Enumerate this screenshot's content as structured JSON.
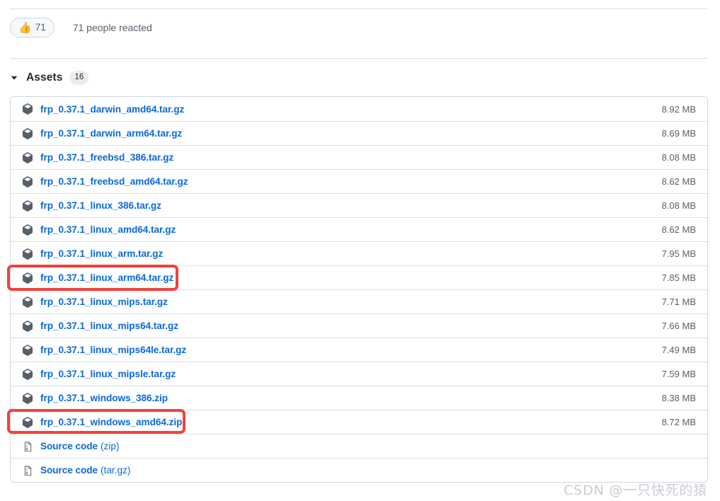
{
  "reactions": {
    "emoji": "thumbs-up-icon",
    "emoji_glyph": "👍",
    "count": "71",
    "summary": "71 people reacted"
  },
  "assets": {
    "toggle_icon": "chevron-down-icon",
    "title": "Assets",
    "count": "16",
    "rows": [
      {
        "icon": "package-icon",
        "name": "frp_0.37.1_darwin_amd64.tar.gz",
        "suffix": "",
        "size": "8.92 MB",
        "highlighted": false
      },
      {
        "icon": "package-icon",
        "name": "frp_0.37.1_darwin_arm64.tar.gz",
        "suffix": "",
        "size": "8.69 MB",
        "highlighted": false
      },
      {
        "icon": "package-icon",
        "name": "frp_0.37.1_freebsd_386.tar.gz",
        "suffix": "",
        "size": "8.08 MB",
        "highlighted": false
      },
      {
        "icon": "package-icon",
        "name": "frp_0.37.1_freebsd_amd64.tar.gz",
        "suffix": "",
        "size": "8.62 MB",
        "highlighted": false
      },
      {
        "icon": "package-icon",
        "name": "frp_0.37.1_linux_386.tar.gz",
        "suffix": "",
        "size": "8.08 MB",
        "highlighted": false
      },
      {
        "icon": "package-icon",
        "name": "frp_0.37.1_linux_amd64.tar.gz",
        "suffix": "",
        "size": "8.62 MB",
        "highlighted": false
      },
      {
        "icon": "package-icon",
        "name": "frp_0.37.1_linux_arm.tar.gz",
        "suffix": "",
        "size": "7.95 MB",
        "highlighted": false
      },
      {
        "icon": "package-icon",
        "name": "frp_0.37.1_linux_arm64.tar.gz",
        "suffix": "",
        "size": "7.85 MB",
        "highlighted": true
      },
      {
        "icon": "package-icon",
        "name": "frp_0.37.1_linux_mips.tar.gz",
        "suffix": "",
        "size": "7.71 MB",
        "highlighted": false
      },
      {
        "icon": "package-icon",
        "name": "frp_0.37.1_linux_mips64.tar.gz",
        "suffix": "",
        "size": "7.66 MB",
        "highlighted": false
      },
      {
        "icon": "package-icon",
        "name": "frp_0.37.1_linux_mips64le.tar.gz",
        "suffix": "",
        "size": "7.49 MB",
        "highlighted": false
      },
      {
        "icon": "package-icon",
        "name": "frp_0.37.1_linux_mipsle.tar.gz",
        "suffix": "",
        "size": "7.59 MB",
        "highlighted": false
      },
      {
        "icon": "package-icon",
        "name": "frp_0.37.1_windows_386.zip",
        "suffix": "",
        "size": "8.38 MB",
        "highlighted": false
      },
      {
        "icon": "package-icon",
        "name": "frp_0.37.1_windows_amd64.zip",
        "suffix": "",
        "size": "8.72 MB",
        "highlighted": true
      },
      {
        "icon": "file-zip-icon",
        "name": "Source code",
        "suffix": "(zip)",
        "size": "",
        "highlighted": false
      },
      {
        "icon": "file-zip-icon",
        "name": "Source code",
        "suffix": "(tar.gz)",
        "size": "",
        "highlighted": false
      }
    ]
  },
  "annotations": [
    {
      "target": "frp_0.37.1_linux_arm64.tar.gz",
      "color": "#f0423c"
    },
    {
      "target": "frp_0.37.1_windows_amd64.zip",
      "color": "#f0423c"
    }
  ],
  "watermark": {
    "text": "CSDN @一只快死的猿",
    "color": "#c9ccd1"
  }
}
